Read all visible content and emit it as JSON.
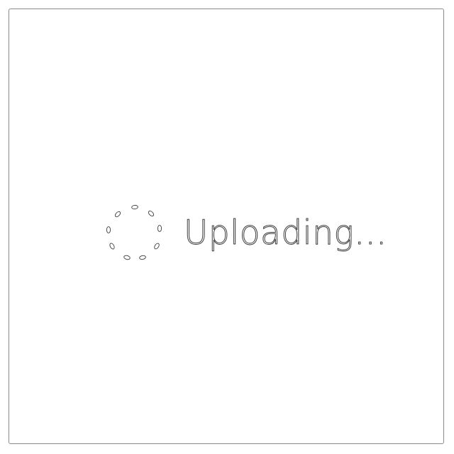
{
  "upload_status": {
    "text": "Uploading...",
    "icon": "loading-spinner-icon"
  },
  "colors": {
    "background": "#ffffff",
    "frame_border": "#8a8a8a",
    "outline": "#3c3c3c"
  }
}
